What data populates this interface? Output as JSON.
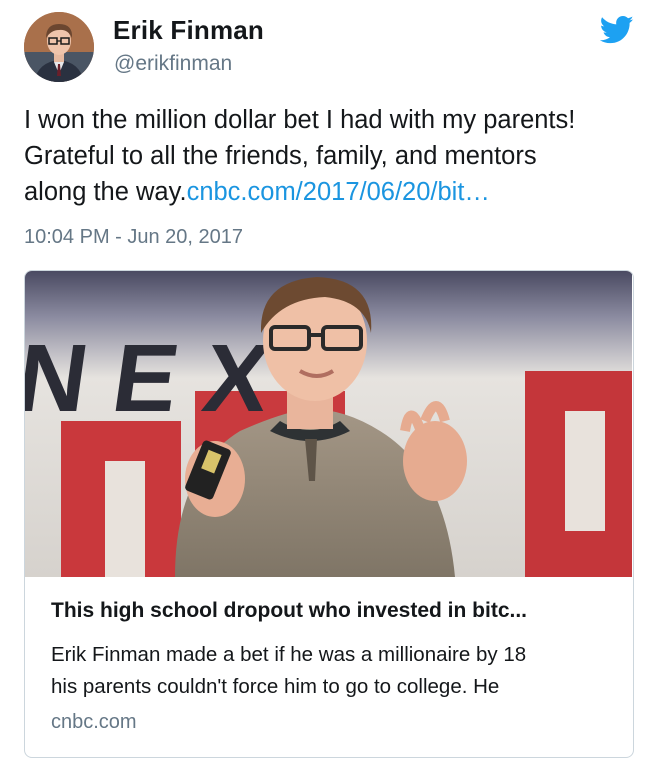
{
  "author": {
    "name": "Erik Finman",
    "handle": "@erikfinman",
    "avatar_icon": "profile-photo"
  },
  "tweet": {
    "text_line1": "I won the million dollar bet I had with my parents!",
    "text_line2": "Grateful to all the friends, family, and mentors",
    "text_line3": "along the way.",
    "link_text": "cnbc.com/2017/06/20/bit…",
    "timestamp": "10:04 PM - Jun 20, 2017"
  },
  "card": {
    "image_subject": "young man with glasses speaking on stage",
    "title": "This high school dropout who invested in bitc...",
    "desc_line1": "Erik Finman made a bet if he was a millionaire by 18",
    "desc_line2": "his parents couldn't force him to go to college. He",
    "domain": "cnbc.com"
  },
  "colors": {
    "twitter_blue": "#1da1f2",
    "link_blue": "#1b95e0",
    "secondary_text": "#657786",
    "border": "#ccd6dd"
  }
}
